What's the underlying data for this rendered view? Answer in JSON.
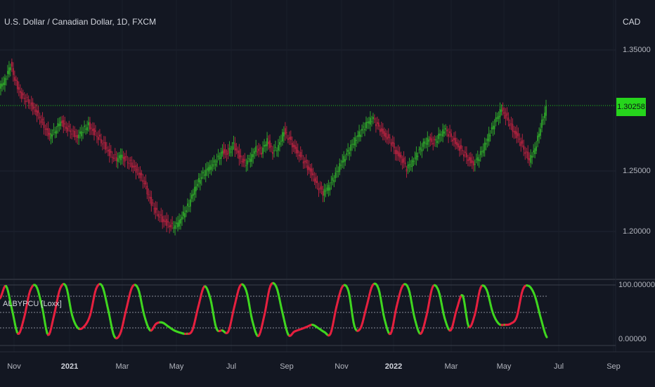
{
  "header": {
    "symbol_title": "U.S. Dollar / Canadian Dollar, 1D, FXCM",
    "currency": "CAD"
  },
  "price_axis": {
    "labels": [
      "1.35000",
      "1.25000",
      "1.20000"
    ],
    "last_price": "1.30258"
  },
  "indicator": {
    "name": "ALBYPCU [Loxx]",
    "axis_labels": [
      "100.00000",
      "0.00000"
    ]
  },
  "time_axis": {
    "labels": [
      "Nov",
      "2021",
      "Mar",
      "May",
      "Jul",
      "Sep",
      "Nov",
      "2022",
      "Mar",
      "May",
      "Jul",
      "Sep"
    ]
  },
  "colors": {
    "background": "#131722",
    "up": "#2fa52a",
    "down": "#b3223f",
    "osc_up": "#3fd61f",
    "osc_down": "#e5203f",
    "last_price_line": "#22c41a"
  },
  "chart_data": [
    {
      "type": "line",
      "series": [
        {
          "values": [
            1.318,
            1.325,
            1.338,
            1.322,
            1.312,
            1.308,
            1.303,
            1.296,
            1.287,
            1.279,
            1.283,
            1.291,
            1.286,
            1.282,
            1.278,
            1.284,
            1.288,
            1.282,
            1.276,
            1.27,
            1.263,
            1.26,
            1.262,
            1.258,
            1.254,
            1.248,
            1.24,
            1.226,
            1.217,
            1.211,
            1.207,
            1.204,
            1.206,
            1.214,
            1.223,
            1.235,
            1.244,
            1.25,
            1.254,
            1.259,
            1.266,
            1.265,
            1.272,
            1.262,
            1.256,
            1.26,
            1.268,
            1.266,
            1.275,
            1.266,
            1.27,
            1.283,
            1.276,
            1.268,
            1.262,
            1.255,
            1.248,
            1.238,
            1.232,
            1.236,
            1.245,
            1.254,
            1.262,
            1.27,
            1.277,
            1.284,
            1.29,
            1.293,
            1.286,
            1.28,
            1.276,
            1.266,
            1.261,
            1.252,
            1.257,
            1.265,
            1.272,
            1.276,
            1.274,
            1.28,
            1.284,
            1.278,
            1.272,
            1.266,
            1.26,
            1.256,
            1.262,
            1.271,
            1.282,
            1.292,
            1.301,
            1.294,
            1.284,
            1.278,
            1.268,
            1.259,
            1.268,
            1.286,
            1.302
          ]
        }
      ]
    },
    {
      "type": "line",
      "title": "ALBYPCU [Loxx]",
      "ylim": [
        0,
        100
      ],
      "series": [
        {
          "values": [
            75,
            97,
            55,
            12,
            40,
            88,
            97,
            60,
            10,
            45,
            92,
            96,
            45,
            22,
            25,
            45,
            92,
            97,
            55,
            8,
            12,
            55,
            95,
            92,
            45,
            18,
            30,
            32,
            25,
            18,
            14,
            12,
            18,
            60,
            96,
            75,
            22,
            18,
            16,
            60,
            98,
            88,
            35,
            8,
            45,
            97,
            95,
            50,
            10,
            16,
            20,
            24,
            28,
            22,
            15,
            12,
            60,
            96,
            88,
            25,
            22,
            60,
            98,
            92,
            38,
            12,
            60,
            97,
            92,
            40,
            12,
            45,
            95,
            88,
            40,
            18,
            55,
            80,
            25,
            45,
            94,
            90,
            50,
            30,
            28,
            30,
            42,
            90,
            97,
            80,
            40,
            6
          ]
        }
      ]
    }
  ]
}
